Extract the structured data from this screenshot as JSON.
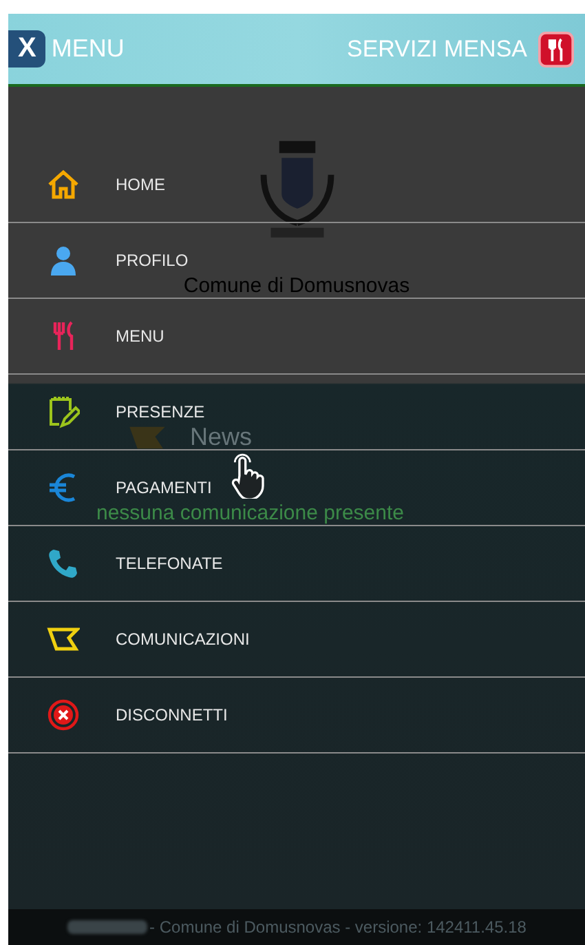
{
  "header": {
    "close_label": "X",
    "title": "MENU",
    "app_title": "SERVIZI MENSA"
  },
  "background": {
    "municipality": "Comune di Domusnovas",
    "news_title": "News",
    "news_empty": "nessuna comunicazione presente"
  },
  "menu": [
    {
      "kind": "home",
      "label": "HOME"
    },
    {
      "kind": "profile",
      "label": "PROFILO"
    },
    {
      "kind": "cutlery",
      "label": "MENU"
    },
    {
      "kind": "notepad",
      "label": "PRESENZE"
    },
    {
      "kind": "euro",
      "label": "PAGAMENTI"
    },
    {
      "kind": "phone",
      "label": "TELEFONATE"
    },
    {
      "kind": "megaphone",
      "label": "COMUNICAZIONI"
    },
    {
      "kind": "logout",
      "label": "DISCONNETTI"
    }
  ],
  "footer": {
    "text": "- Comune di Domusnovas - versione: 142411.45.18"
  }
}
